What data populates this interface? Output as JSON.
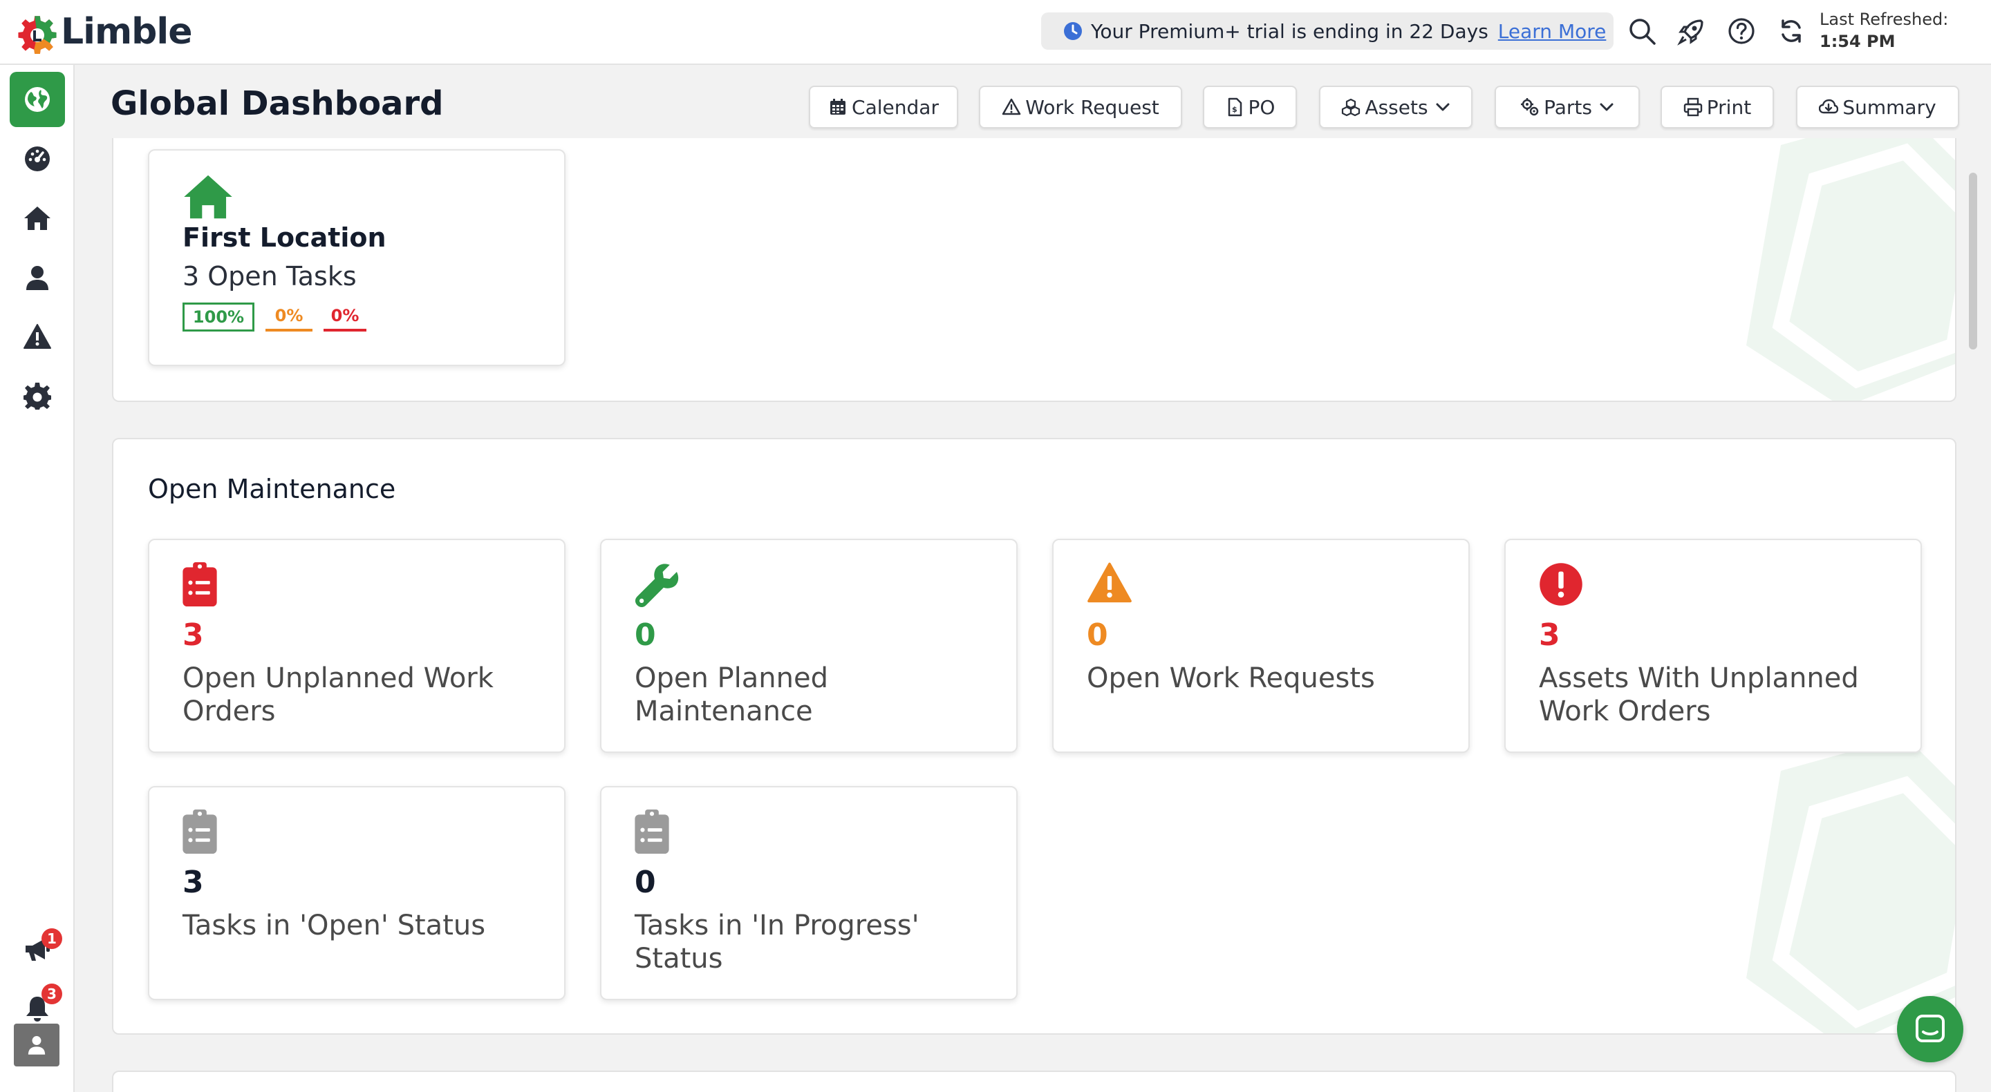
{
  "app": {
    "brand": "Limble"
  },
  "trial": {
    "message": "Your Premium+ trial is ending in 22 Days",
    "link": "Learn More"
  },
  "refresh": {
    "label": "Last Refreshed:",
    "time": "1:54 PM"
  },
  "topbar_icons": [
    "search-icon",
    "rocket-icon",
    "help-icon",
    "refresh-icon"
  ],
  "sidebar": {
    "items": [
      {
        "name": "globe",
        "active": true
      },
      {
        "name": "dashboard"
      },
      {
        "name": "home"
      },
      {
        "name": "user"
      },
      {
        "name": "warning"
      },
      {
        "name": "settings"
      }
    ],
    "announcements_badge": "1",
    "notifications_badge": "3"
  },
  "page": {
    "title": "Global Dashboard"
  },
  "header_buttons": {
    "calendar": "Calendar",
    "work_request": "Work Request",
    "po": "PO",
    "assets": "Assets",
    "parts": "Parts",
    "print": "Print",
    "summary": "Summary"
  },
  "location": {
    "name": "First Location",
    "open_tasks": "3 Open Tasks",
    "pct_green": "100%",
    "pct_orange": "0%",
    "pct_red": "0%"
  },
  "open_maintenance": {
    "title": "Open Maintenance",
    "cards": [
      {
        "value": "3",
        "label": "Open Unplanned Work Orders"
      },
      {
        "value": "0",
        "label": "Open Planned Maintenance"
      },
      {
        "value": "0",
        "label": "Open Work Requests"
      },
      {
        "value": "3",
        "label": "Assets With Unplanned Work Orders"
      },
      {
        "value": "3",
        "label": "Tasks in 'Open' Status"
      },
      {
        "value": "0",
        "label": "Tasks in 'In Progress' Status"
      }
    ]
  },
  "colors": {
    "green": "#2f9a48",
    "orange": "#ee8a22",
    "red": "#e0262f",
    "gray": "#9b9b9b",
    "navy": "#141c2c",
    "link": "#3b6fd6"
  }
}
